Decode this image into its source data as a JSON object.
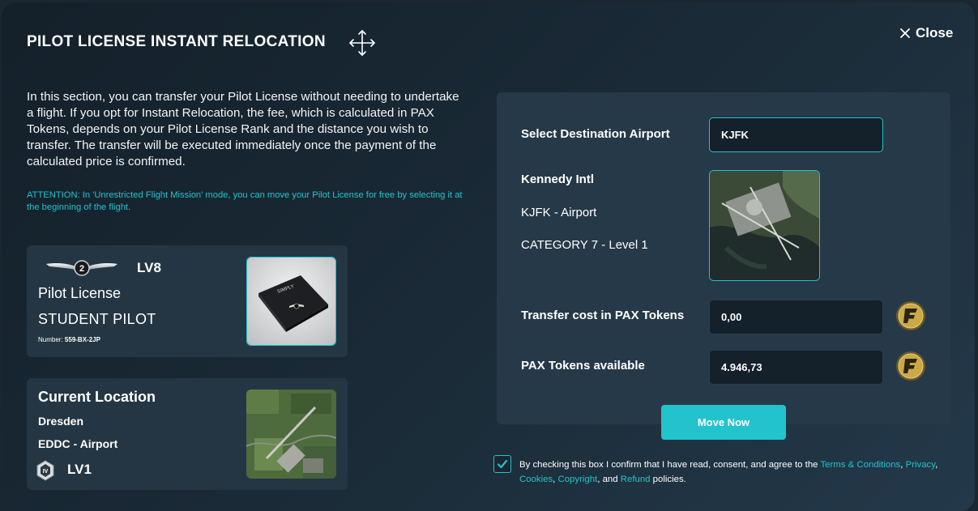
{
  "header": {
    "title": "PILOT LICENSE INSTANT RELOCATION",
    "close_label": "Close"
  },
  "intro": {
    "text": "In this section, you can transfer your Pilot License without needing to undertake a flight. If you opt for Instant Relocation, the fee, which is calculated in PAX Tokens, depends on your Pilot License Rank and the distance you wish to transfer. The transfer will be executed immediately once the payment of the calculated price is confirmed.",
    "attention": "ATTENTION: In 'Unrestricted Flight Mission' mode, you can move your Pilot License for free by selecting it at the beginning of the flight."
  },
  "license_card": {
    "wings_badge": "2",
    "level": "LV8",
    "label": "Pilot License",
    "rank": "STUDENT PILOT",
    "number_label": "Number:",
    "number": "559-BX-2JP",
    "image_text": "SIMPLY"
  },
  "location_card": {
    "title": "Current Location",
    "city": "Dresden",
    "code": "EDDC - Airport",
    "badge": "IV",
    "level": "LV1"
  },
  "destination": {
    "select_label": "Select Destination Airport",
    "input_value": "KJFK",
    "airport_name": "Kennedy Intl",
    "airport_code": "KJFK - Airport",
    "category": "CATEGORY 7 - Level 1",
    "cost_label": "Transfer cost in PAX Tokens",
    "cost_value": "0,00",
    "available_label": "PAX Tokens available",
    "available_value": "4.946,73"
  },
  "actions": {
    "move_now": "Move Now"
  },
  "consent": {
    "prefix": "By checking this box I confirm that I have read, consent, and agree to the",
    "terms": "Terms & Conditions",
    "comma1": ",",
    "privacy": "Privacy",
    "comma2": ",",
    "cookies": "Cookies",
    "comma3": ",",
    "copyright": "Copyright",
    "and": ", and",
    "refund": "Refund",
    "suffix": "policies.",
    "checked": true
  },
  "colors": {
    "accent": "#22c3cc",
    "panel": "#263948",
    "card": "#243643"
  },
  "icons": {
    "move": "move-arrows-icon",
    "close": "close-icon",
    "token": "pax-token-icon",
    "check": "check-icon"
  }
}
